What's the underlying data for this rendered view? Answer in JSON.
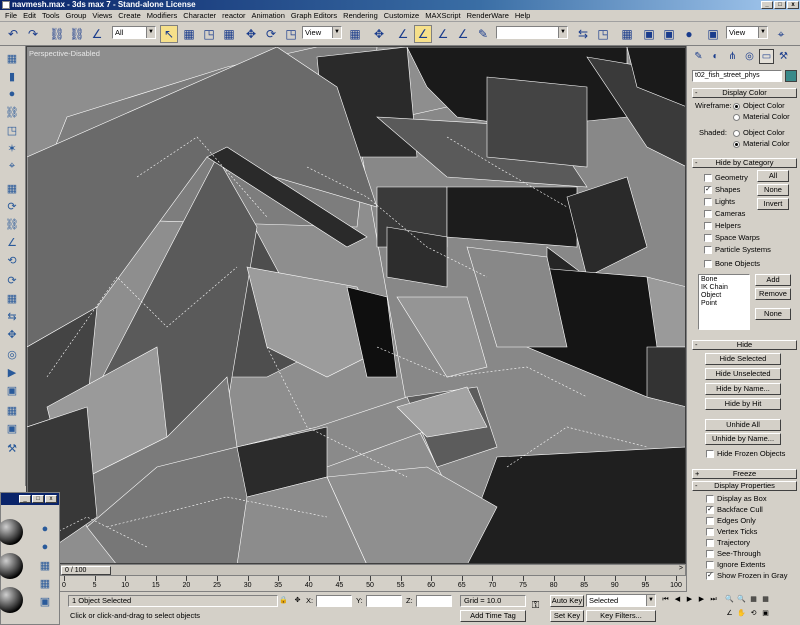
{
  "window": {
    "title": "navmesh.max - 3ds max 7 - Stand-alone License",
    "min_label": "_",
    "max_label": "□",
    "close_label": "x"
  },
  "menu": [
    "File",
    "Edit",
    "Tools",
    "Group",
    "Views",
    "Create",
    "Modifiers",
    "Character",
    "reactor",
    "Animation",
    "Graph Editors",
    "Rendering",
    "Customize",
    "MAXScript",
    "RenderWare",
    "Help"
  ],
  "toolbar": {
    "selection_filter": "All",
    "reference_coord": "View",
    "named_selection": "",
    "viewport_layout": "View"
  },
  "viewport": {
    "label": "Perspective-Disabled"
  },
  "timeline": {
    "frame_indicator": "0 / 100",
    "ticks": [
      "0",
      "5",
      "10",
      "15",
      "20",
      "25",
      "30",
      "35",
      "40",
      "45",
      "50",
      "55",
      "60",
      "65",
      "70",
      "75",
      "80",
      "85",
      "90",
      "95",
      "100"
    ]
  },
  "status": {
    "selection_info": "1 Object Selected",
    "prompt": "Click or click-and-drag to select objects",
    "x_label": "X:",
    "y_label": "Y:",
    "z_label": "Z:",
    "x_value": "",
    "y_value": "",
    "z_value": "",
    "grid": "Grid = 10.0",
    "add_time_tag": "Add Time Tag",
    "auto_key": "Auto Key",
    "set_key": "Set Key",
    "key_mode": "Selected",
    "key_filters": "Key Filters..."
  },
  "command_panel": {
    "object_name": "t02_fish_street_phys",
    "display_color": {
      "title": "Display Color",
      "wireframe_label": "Wireframe:",
      "shaded_label": "Shaded:",
      "object_color": "Object Color",
      "material_color": "Material Color"
    },
    "hide_by_category": {
      "title": "Hide by Category",
      "categories": [
        {
          "label": "Geometry",
          "checked": false
        },
        {
          "label": "Shapes",
          "checked": true
        },
        {
          "label": "Lights",
          "checked": false
        },
        {
          "label": "Cameras",
          "checked": false
        },
        {
          "label": "Helpers",
          "checked": false
        },
        {
          "label": "Space Warps",
          "checked": false
        },
        {
          "label": "Particle Systems",
          "checked": false
        },
        {
          "label": "Bone Objects",
          "checked": false
        }
      ],
      "all_btn": "All",
      "none_btn": "None",
      "invert_btn": "Invert",
      "list_items": [
        "Bone",
        "IK Chain Object",
        "Point"
      ],
      "add_btn": "Add",
      "remove_btn": "Remove",
      "none2_btn": "None"
    },
    "hide": {
      "title": "Hide",
      "buttons": [
        "Hide Selected",
        "Hide Unselected",
        "Hide by Name...",
        "Hide by Hit"
      ],
      "unhide_buttons": [
        "Unhide All",
        "Unhide by Name..."
      ],
      "hide_frozen": "Hide Frozen Objects"
    },
    "freeze": {
      "title": "Freeze"
    },
    "display_properties": {
      "title": "Display Properties",
      "options": [
        {
          "label": "Display as Box",
          "checked": false
        },
        {
          "label": "Backface Cull",
          "checked": true
        },
        {
          "label": "Edges Only",
          "checked": false
        },
        {
          "label": "Vertex Ticks",
          "checked": false
        },
        {
          "label": "Trajectory",
          "checked": false
        },
        {
          "label": "See-Through",
          "checked": false
        },
        {
          "label": "Ignore Extents",
          "checked": false
        },
        {
          "label": "Show Frozen in Gray",
          "checked": true
        }
      ]
    },
    "rollout_minus": "-",
    "rollout_plus": "+",
    "check_mark": "✓"
  },
  "icons": {
    "undo": "↶",
    "redo": "↷",
    "select": "↖",
    "move": "✥",
    "rotate": "⟳",
    "scale": "◳",
    "snap": "∠",
    "mirror": "⇆",
    "render": "▣",
    "create": "✎",
    "modify": "◐",
    "hierarchy": "⋔",
    "motion": "◎",
    "display": "▭",
    "utilities": "⚒",
    "key": "⚿",
    "play": "▶",
    "prev": "⏮",
    "next": "⏭",
    "stepback": "◀",
    "stepfwd": "▶",
    "zoom": "🔍",
    "pan": "✋",
    "orbit": "⟲",
    "lock": "🔒",
    "cube": "▦",
    "sphere": "●",
    "cylinder": "▮",
    "link": "⛓",
    "camera": "⌖",
    "light": "✶"
  },
  "colors": {
    "accent_active": "#f6e08a",
    "title_bar": "#0a246a",
    "object_swatch": "#3a8a8a"
  }
}
